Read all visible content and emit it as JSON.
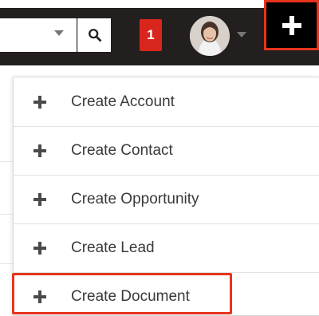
{
  "header": {
    "notification_count": "1",
    "icons": {
      "search": "search-icon",
      "dropdown": "chevron-down-icon",
      "plus": "plus-icon"
    },
    "colors": {
      "navbar": "#231f1e",
      "badge": "#d9261c",
      "highlight": "#e8341c"
    }
  },
  "create_menu": {
    "items": [
      {
        "label": "Create Account"
      },
      {
        "label": "Create Contact"
      },
      {
        "label": "Create Opportunity"
      },
      {
        "label": "Create Lead"
      },
      {
        "label": "Create Document"
      }
    ]
  }
}
